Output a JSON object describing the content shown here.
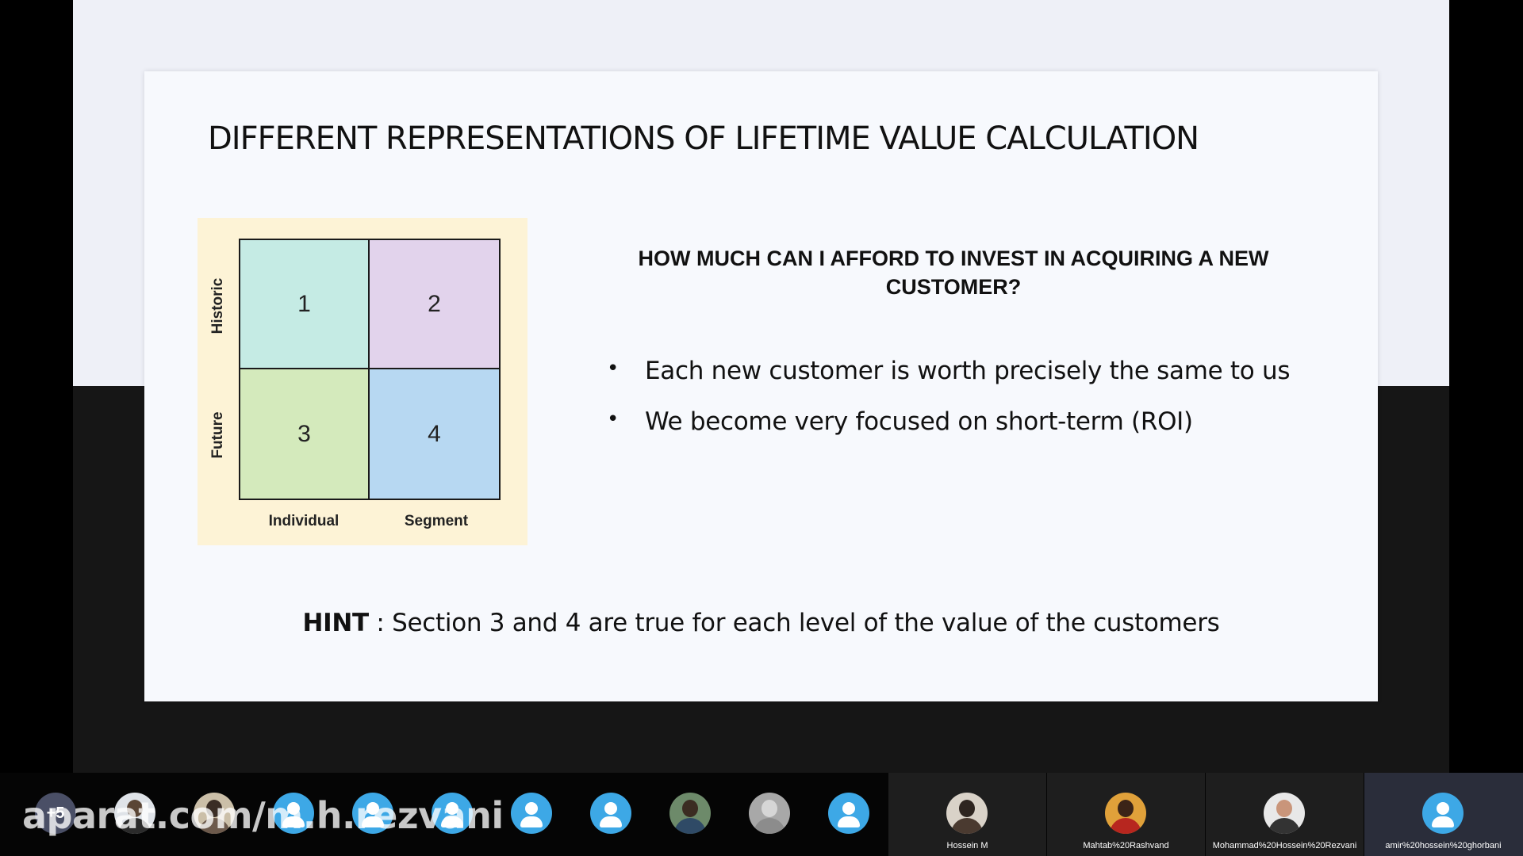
{
  "slide": {
    "title": "DIFFERENT REPRESENTATIONS OF LIFETIME VALUE CALCULATION",
    "matrix": {
      "cells": [
        "1",
        "2",
        "3",
        "4"
      ],
      "row_labels": [
        "Historic",
        "Future"
      ],
      "column_labels": [
        "Individual",
        "Segment"
      ],
      "colors": {
        "cell1": "#c5ebe4",
        "cell2": "#e2d3ec",
        "cell3": "#d4eabc",
        "cell4": "#b7d8f2",
        "panel": "#fdf3d6"
      }
    },
    "question": "HOW MUCH CAN I AFFORD TO INVEST IN ACQUIRING A NEW CUSTOMER?",
    "bullet_symbol": "•",
    "bullets": [
      "Each new customer is worth precisely the same to us",
      "We become very focused on short-term (ROI)"
    ],
    "hint": {
      "label": "HINT",
      "text": " : Section 3 and 4 are true for each level of the value of the customers"
    }
  },
  "participants": {
    "more_count": "+5",
    "named": [
      {
        "name": "Hossein M",
        "avatar": "photo"
      },
      {
        "name": "Mahtab%20Rashvand",
        "avatar": "photo"
      },
      {
        "name": "Mohammad%20Hossein%20Rezvani",
        "avatar": "photo"
      },
      {
        "name": "amir%20hossein%20ghorbani",
        "avatar": "default-user-icon"
      }
    ]
  },
  "watermark": "aparat.com/m.h.rezvani"
}
